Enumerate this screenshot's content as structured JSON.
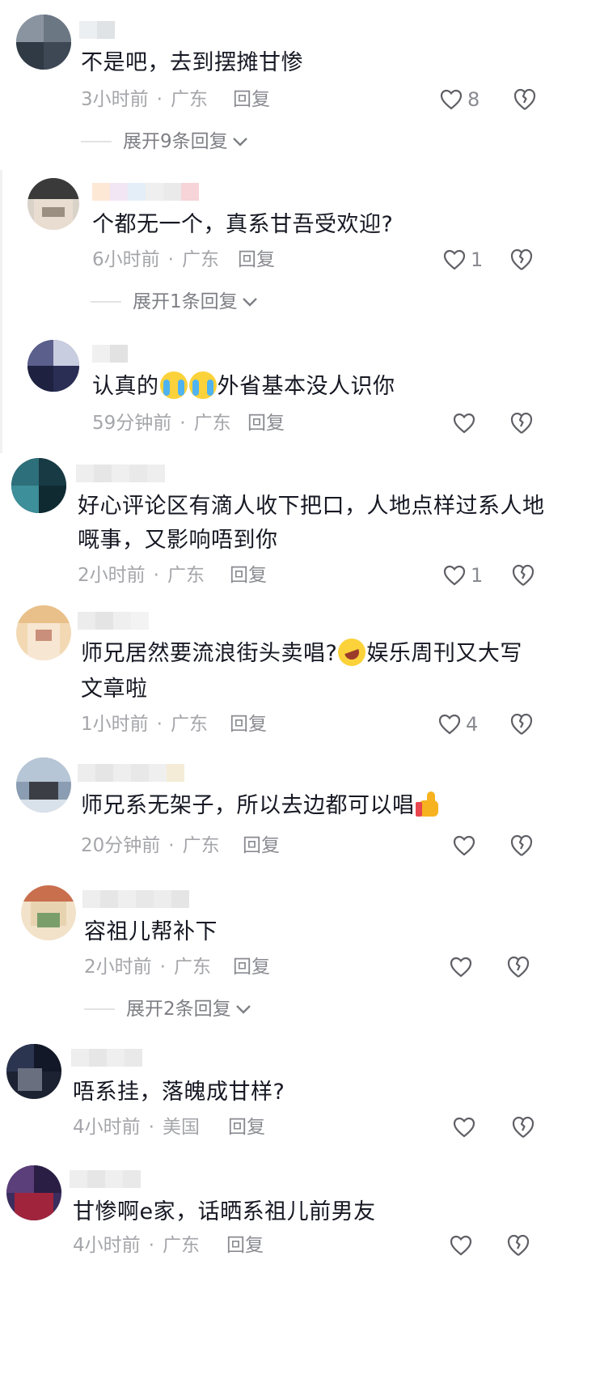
{
  "colors": {
    "text": "#161823",
    "meta": "#a5a6aa",
    "action": "#8a8b91",
    "icon": "#5f6066"
  },
  "comments": [
    {
      "text": "不是吧，去到摆摊甘惨",
      "time": "3小时前",
      "location": "广东",
      "reply": "回复",
      "likes": "8",
      "expand": "展开9条回复"
    },
    {
      "text": "个都无一个，真系甘吾受欢迎?",
      "time": "6小时前",
      "location": "广东",
      "reply": "回复",
      "likes": "1",
      "expand": "展开1条回复"
    },
    {
      "text_a": "认真的",
      "text_b": "外省基本没人识你",
      "emojis": [
        "crying-laughing",
        "crying-laughing"
      ],
      "time": "59分钟前",
      "location": "广东",
      "reply": "回复",
      "likes": ""
    },
    {
      "line1": "好心评论区有滴人收下把口，人地点样过系人地",
      "line2": "嘅事，又影响唔到你",
      "time": "2小时前",
      "location": "广东",
      "reply": "回复",
      "likes": "1"
    },
    {
      "line1_a": "师兄居然要流浪街头卖唱?",
      "line1_b": "娱乐周刊又大写",
      "line2": "文章啦",
      "emoji": "rolling-laughing",
      "time": "1小时前",
      "location": "广东",
      "reply": "回复",
      "likes": "4"
    },
    {
      "text": "师兄系无架子，所以去边都可以唱",
      "emoji": "thumbs-up",
      "time": "20分钟前",
      "location": "广东",
      "reply": "回复",
      "likes": ""
    },
    {
      "text": "容祖儿帮补下",
      "time": "2小时前",
      "location": "广东",
      "reply": "回复",
      "likes": "",
      "expand": "展开2条回复"
    },
    {
      "text": "唔系挂，落魄成甘样?",
      "time": "4小时前",
      "location": "美国",
      "reply": "回复",
      "likes": ""
    },
    {
      "text": "甘惨啊e家，话晒系祖儿前男友",
      "time": "4小时前",
      "location": "广东",
      "reply": "回复",
      "likes": ""
    }
  ],
  "dot": "·"
}
